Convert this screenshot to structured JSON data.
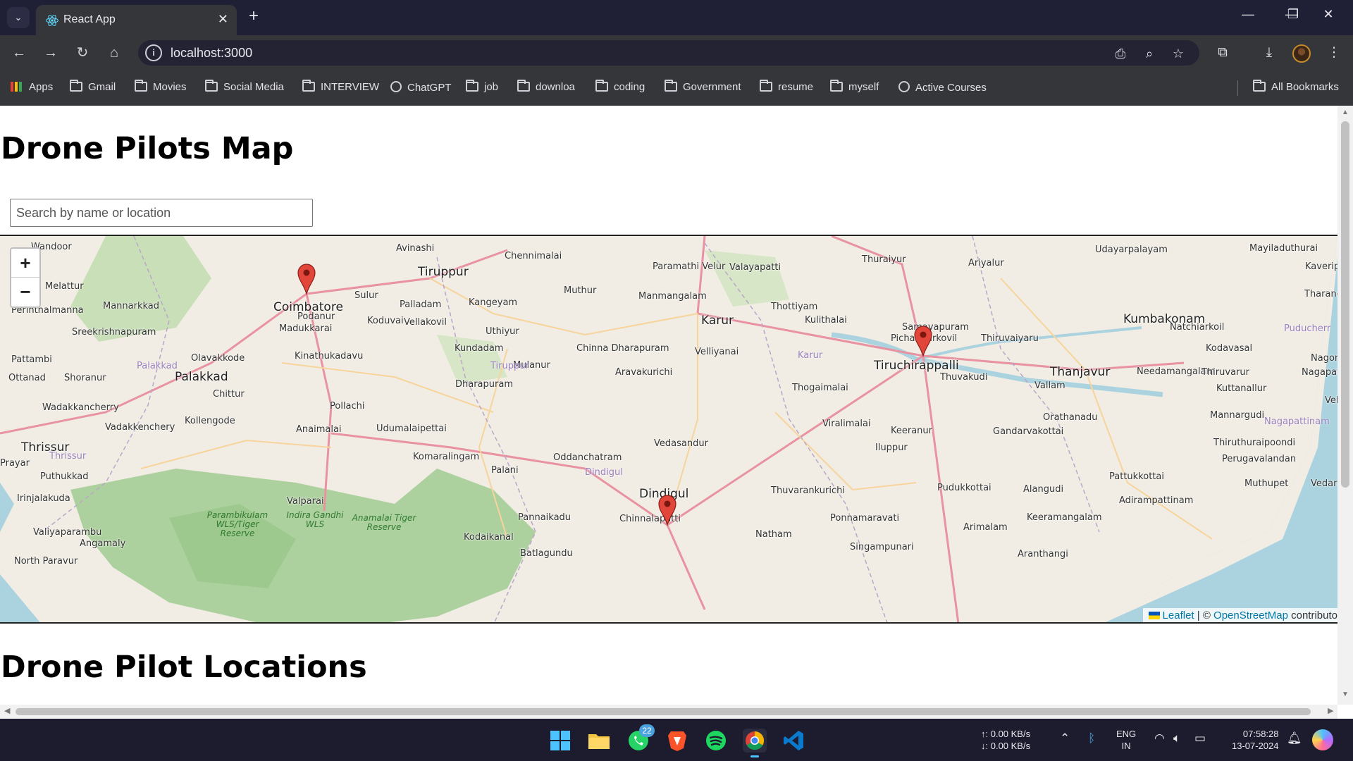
{
  "browser": {
    "tab_title": "React App",
    "url": "localhost:3000",
    "bookmarks": [
      "Apps",
      "Gmail",
      "Movies",
      "Social Media",
      "INTERVIEW",
      "ChatGPT",
      "job",
      "downloa",
      "coding",
      "Government",
      "resume",
      "myself",
      "Active Courses"
    ],
    "all_bookmarks": "All Bookmarks"
  },
  "page": {
    "title": "Drone Pilots Map",
    "search_placeholder": "Search by name or location",
    "section_title": "Drone Pilot Locations"
  },
  "map": {
    "zoom_in": "+",
    "zoom_out": "−",
    "attribution": {
      "leaflet": "Leaflet",
      "sep": " | © ",
      "osm": "OpenStreetMap",
      "suffix": " contributo"
    },
    "markers": [
      "Coimbatore",
      "Tiruchirappalli",
      "Dindigul"
    ],
    "place_labels": {
      "major": [
        "Tiruppur",
        "Coimbatore",
        "Karur",
        "Tiruchirappalli",
        "Thanjavur",
        "Kumbakonam",
        "Palakkad",
        "Thrissur",
        "Dindigul"
      ],
      "minor": [
        "Wandoor",
        "Avinashi",
        "Chennimalai",
        "Paramathi Velur",
        "Valayapatti",
        "Thuraiyur",
        "Ariyalur",
        "Udayarpalayam",
        "Mayiladuthurai",
        "Kaverippa",
        "Melattur",
        "Sulur",
        "Palladam",
        "Kangeyam",
        "Muthur",
        "Manmangalam",
        "Thottiyam",
        "Kulithalai",
        "Samayapuram",
        "Pichandarkovil",
        "Thiruvaiyaru",
        "Natchiarkoil",
        "Tharangai",
        "Perinthalmanna",
        "Mannarkkad",
        "Podanur",
        "Madukkarai",
        "Koduvai",
        "Vellakovil",
        "Uthiyur",
        "Sreekrishnapuram",
        "Kinathukadavu",
        "Kundadam",
        "Chinna Dharapuram",
        "Velliyanai",
        "Kodavasal",
        "Nagore",
        "Pattambi",
        "Olavakkode",
        "Mulanur",
        "Aravakurichi",
        "Thuvakudi",
        "Needamangalam",
        "Thiruvarur",
        "Nagapatti",
        "Ottanad",
        "Shoranur",
        "Dharapuram",
        "Thogaimalai",
        "Vallam",
        "Kuttanallur",
        "Chittur",
        "Velanka",
        "Wadakkancherry",
        "Pollachi",
        "Mannargudi",
        "Kollengode",
        "Orathanadu",
        "Vadakkenchery",
        "Anaimalai",
        "Udumalaipettai",
        "Viralimalai",
        "Keeranur",
        "Gandarvakottai",
        "Vedasandur",
        "Iluppur",
        "Thiruthuraipoondi",
        "Komaralingam",
        "Oddanchatram",
        "Perugavalandan",
        "Puthukkad",
        "Palani",
        "Pattukkottai",
        "Valparai",
        "Thuvarankurichi",
        "Pudukkottai",
        "Alangudi",
        "Muthupet",
        "Irinjalakuda",
        "Adirampattinam",
        "Vedaran",
        "Pannaikadu",
        "Chinnalapatti",
        "Ponnamaravati",
        "Keeramangalam",
        "Valiyaparambu",
        "Kodaikanal",
        "Arimalam",
        "Angamaly",
        "Natham",
        "Singampunari",
        "North Paravur",
        "Batlagundu",
        "Aranthangi",
        "Prayar"
      ],
      "park": [
        "Parambikulam WLS/Tiger Reserve",
        "Indira Gandhi WLS",
        "Anamalai Tiger Reserve"
      ],
      "district": [
        "Palakkad",
        "Tiruppur",
        "Karur",
        "Thrissur",
        "Dindigul",
        "Puducherr",
        "Nagapattinam"
      ]
    }
  },
  "taskbar": {
    "whatsapp_badge": "22",
    "net_up": "↑: 0.00 KB/s",
    "net_down": "↓: 0.00 KB/s",
    "lang": "ENG",
    "region": "IN",
    "time": "07:58:28",
    "date": "13-07-2024"
  },
  "colors": {
    "chrome_bg": "#35363a",
    "titlebar_bg": "#1f1f35",
    "marker": "#e2463a",
    "link": "#0078a8"
  }
}
